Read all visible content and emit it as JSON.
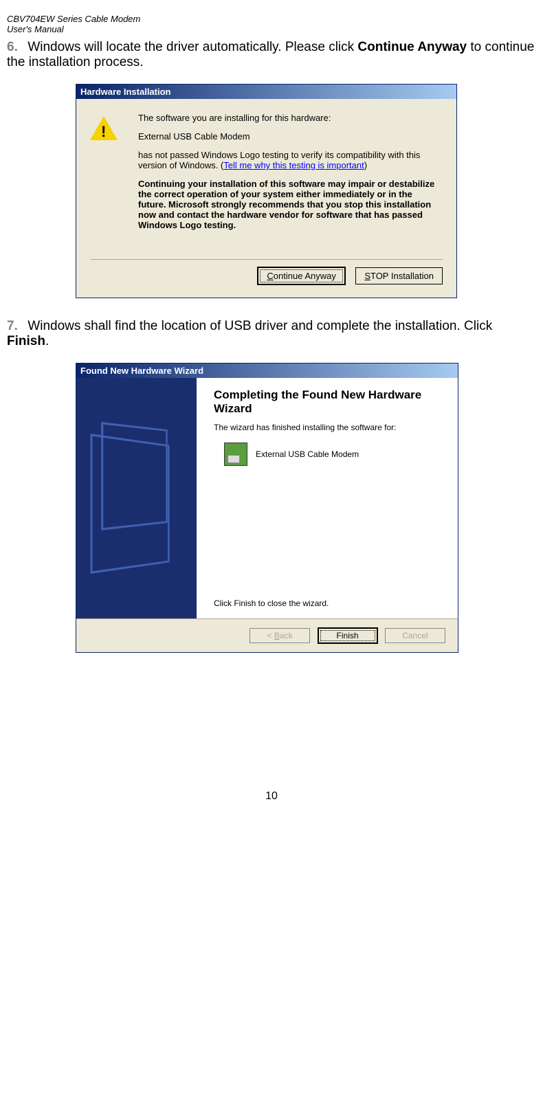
{
  "header": {
    "line1": "CBV704EW Series Cable Modem",
    "line2": "User's Manual"
  },
  "step6": {
    "number": "6.",
    "text_before_bold": "Windows will locate the driver automatically. Please click ",
    "bold1": "Continue Anyway",
    "text_after_bold": " to continue the installation process."
  },
  "dialog1": {
    "title": "Hardware Installation",
    "line1": "The software you are installing for this hardware:",
    "line2": "External USB Cable Modem",
    "line3a": "has not passed Windows Logo testing to verify its compatibility with this version of Windows. (",
    "line3_link": "Tell me why this testing is important",
    "line3b": ")",
    "line4": "Continuing your installation of this software may impair or destabilize the correct operation of your system either immediately or in the future. Microsoft strongly recommends that you stop this installation now and contact the hardware vendor for software that has passed Windows Logo testing.",
    "btn_continue_c": "C",
    "btn_continue_rest": "ontinue Anyway",
    "btn_stop_s": "S",
    "btn_stop_rest": "TOP Installation"
  },
  "step7": {
    "number": "7.",
    "text_before_bold": "Windows shall find the location of USB driver and complete the installation. Click ",
    "bold1": "Finish",
    "text_after_bold": "."
  },
  "dialog2": {
    "title": "Found New Hardware Wizard",
    "heading": "Completing the Found New Hardware Wizard",
    "subtitle": "The wizard has finished installing the software for:",
    "device": "External USB Cable Modem",
    "finish_text": "Click Finish to close the wizard.",
    "btn_back": "< ",
    "btn_back_b": "B",
    "btn_back_rest": "ack",
    "btn_finish": "Finish",
    "btn_cancel": "Cancel"
  },
  "page_number": "10"
}
